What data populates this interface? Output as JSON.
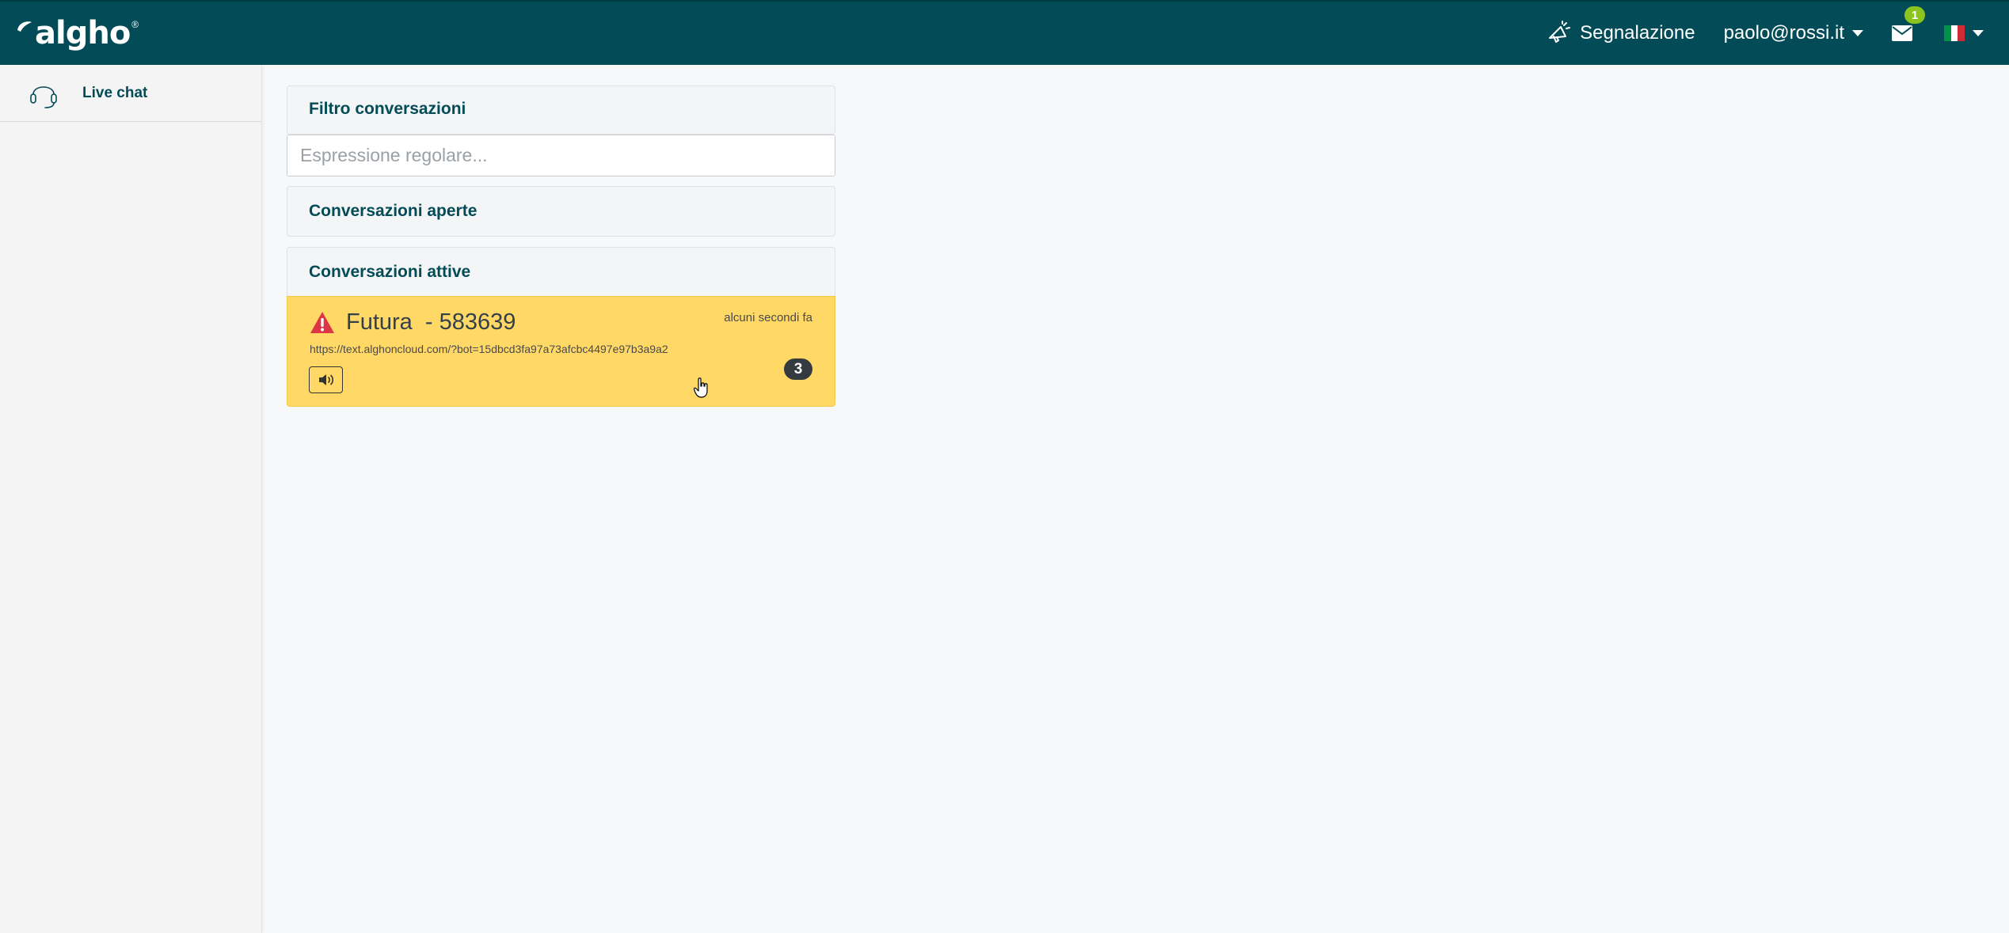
{
  "app": {
    "logo_text": "algho",
    "logo_registered": "®"
  },
  "header": {
    "report_label": "Segnalazione",
    "user_email": "paolo@rossi.it",
    "mail_badge": "1",
    "language_flag": "italian-flag-icon",
    "brand_color": "#034b57"
  },
  "sidebar": {
    "items": [
      {
        "label": "Live chat",
        "icon": "headset-icon"
      }
    ]
  },
  "main": {
    "filter_title": "Filtro conversazioni",
    "filter_placeholder": "Espressione regolare...",
    "open_title": "Conversazioni aperte",
    "active_title": "Conversazioni attive",
    "conversations": [
      {
        "name": "Futura  - 583639",
        "time": "alcuni secondi fa",
        "url": "https://text.alghoncloud.com/?bot=15dbcd3fa97a73afcbc4497e97b3a9a2",
        "unread_count": "3",
        "alert_icon": "warning-icon",
        "sound_icon": "volume-icon",
        "highlight_color": "#ffd866"
      }
    ]
  }
}
